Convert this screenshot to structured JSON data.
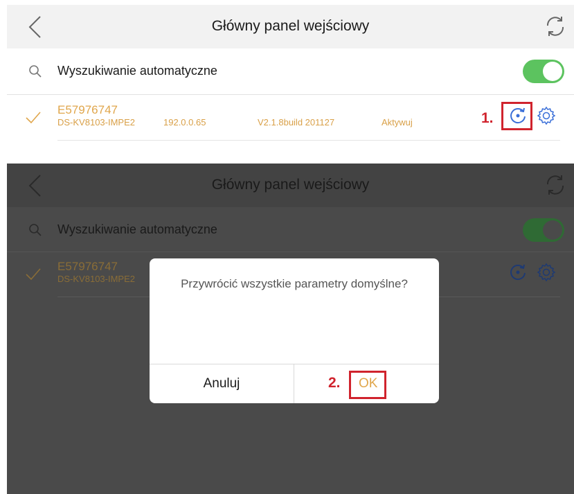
{
  "header": {
    "title": "Główny panel wejściowy"
  },
  "search": {
    "label": "Wyszukiwanie automatyczne",
    "toggle_on": true,
    "toggle_color_top": "#5cc35f",
    "toggle_color_dim": "#2f6a34"
  },
  "device": {
    "serial": "E57976747",
    "model": "DS-KV8103-IMPE2",
    "ip": "192.0.0.65",
    "version": "V2.1.8build 201127",
    "status": "Aktywuj"
  },
  "annotations": {
    "step1": "1.",
    "step2": "2."
  },
  "dialog": {
    "message": "Przywrócić wszystkie parametry domyślne?",
    "cancel_label": "Anuluj",
    "ok_label": "OK"
  },
  "icons": [
    "back-icon",
    "refresh-icon",
    "search-icon",
    "check-icon",
    "restore-icon",
    "gear-icon"
  ],
  "colors": {
    "accent": "#e0a64b",
    "icon_blue": "#3a6fd8",
    "highlight_red": "#d0232d"
  }
}
